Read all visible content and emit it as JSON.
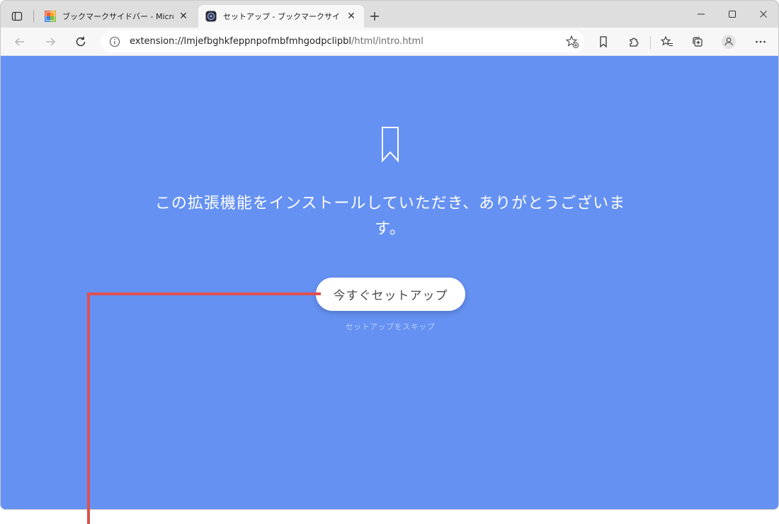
{
  "browser": {
    "tabs": [
      {
        "title": "ブックマークサイドバー - Microsoft Edge",
        "active": false
      },
      {
        "title": "セットアップ - ブックマークサイドバー",
        "active": true
      }
    ],
    "address": {
      "scheme_host": "extension://lmjefbghkfeppnpofmbfmhgodpclipbl",
      "path": "/html/intro.html"
    },
    "icons": {
      "tab_actions": "tab-actions-icon",
      "new_tab": "plus-icon",
      "back": "arrow-left-icon",
      "forward": "arrow-right-icon",
      "refresh": "refresh-icon",
      "info": "info-icon",
      "add_favorite": "star-plus-icon",
      "bookmark": "bookmark-icon",
      "extensions": "puzzle-icon",
      "favorites": "favorites-list-icon",
      "collections": "collections-icon",
      "profile": "profile-icon",
      "more": "more-icon"
    }
  },
  "page": {
    "headline": "この拡張機能をインストールしていただき、ありがとうございます。",
    "setup_button": "今すぐセットアップ",
    "skip_link": "セットアップをスキップ"
  },
  "colors": {
    "page_background": "#6591f2",
    "annotation": "#e05050"
  }
}
